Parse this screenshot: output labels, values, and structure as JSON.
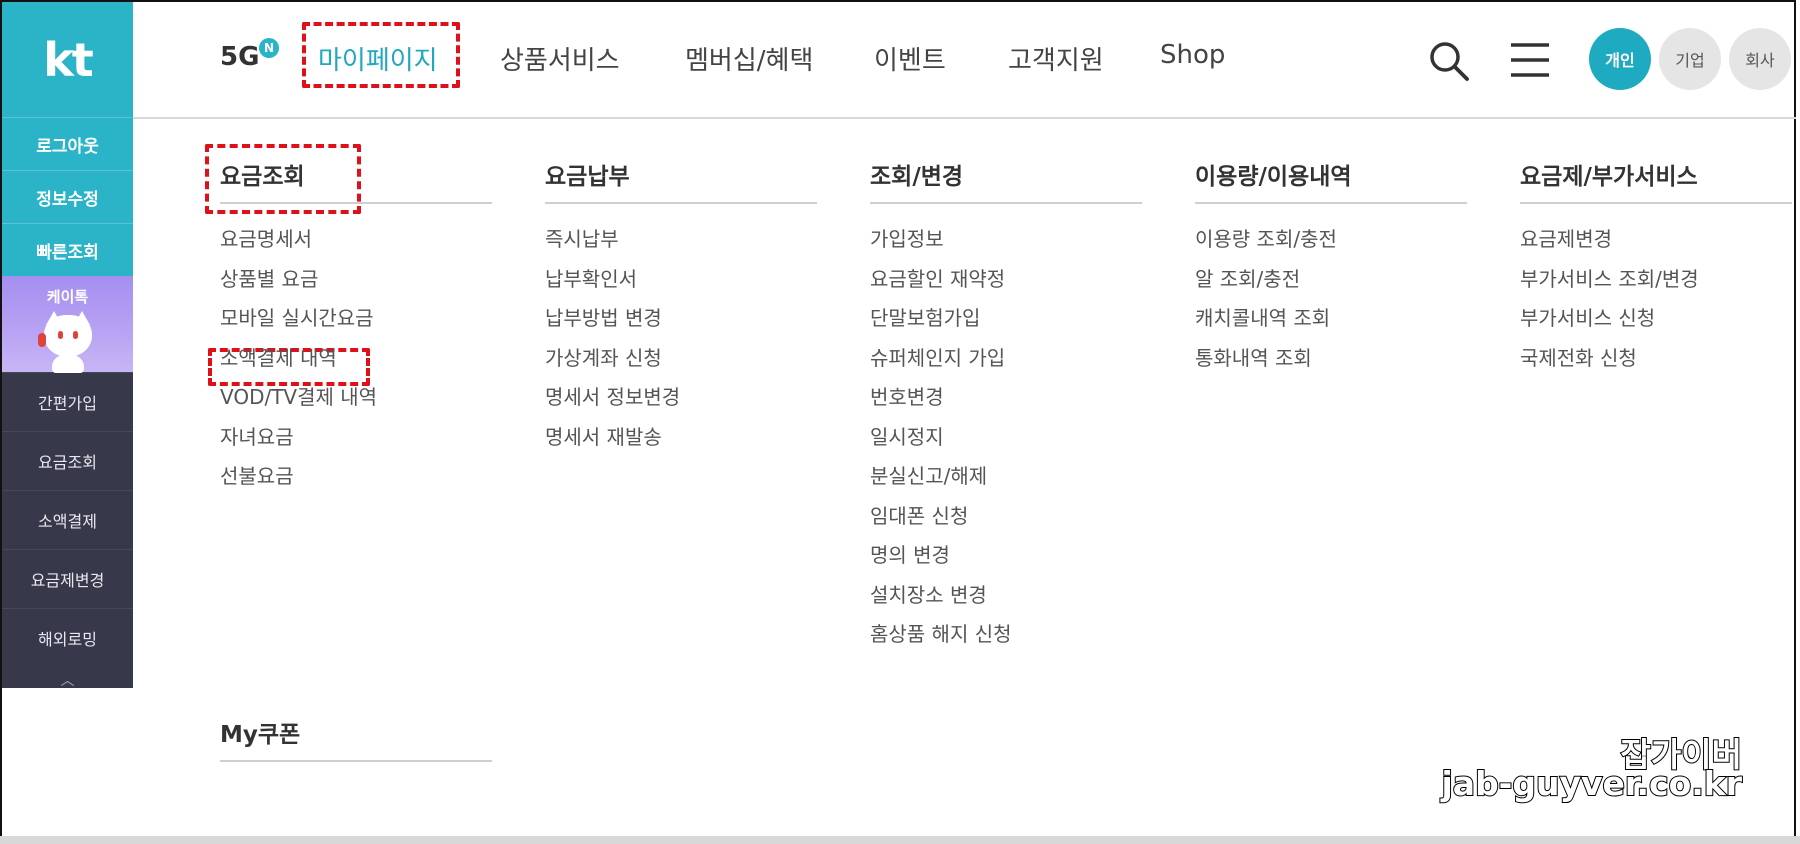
{
  "sidebar": {
    "logo": "kt",
    "quick_items": [
      "로그아웃",
      "정보수정",
      "빠른조회"
    ],
    "ktalk_label": "케이톡",
    "items": [
      "간편가입",
      "요금조회",
      "소액결제",
      "요금제변경",
      "해외로밍"
    ],
    "collapse_glyph": "︿"
  },
  "header": {
    "brand": "5G",
    "badge": "N",
    "nav": [
      "마이페이지",
      "상품서비스",
      "멤버십/혜택",
      "이벤트",
      "고객지원",
      "Shop"
    ],
    "segments": [
      "개인",
      "기업",
      "회사"
    ],
    "accent_color": "#2bb3c7"
  },
  "menu": {
    "columns": [
      {
        "title": "요금조회",
        "items": [
          "요금명세서",
          "상품별 요금",
          "모바일 실시간요금",
          "소액결제 내역",
          "VOD/TV결제 내역",
          "자녀요금",
          "선불요금"
        ]
      },
      {
        "title": "요금납부",
        "items": [
          "즉시납부",
          "납부확인서",
          "납부방법 변경",
          "가상계좌 신청",
          "명세서 정보변경",
          "명세서 재발송"
        ]
      },
      {
        "title": "조회/변경",
        "items": [
          "가입정보",
          "요금할인 재약정",
          "단말보험가입",
          "슈퍼체인지 가입",
          "번호변경",
          "일시정지",
          "분실신고/해제",
          "임대폰 신청",
          "명의 변경",
          "설치장소 변경",
          "홈상품 해지 신청"
        ]
      },
      {
        "title": "이용량/이용내역",
        "items": [
          "이용량 조회/충전",
          "알 조회/충전",
          "캐치콜내역 조회",
          "통화내역 조회"
        ]
      },
      {
        "title": "요금제/부가서비스",
        "items": [
          "요금제변경",
          "부가서비스 조회/변경",
          "부가서비스 신청",
          "국제전화 신청"
        ]
      }
    ],
    "coupon_title": "My쿠폰"
  },
  "watermark": {
    "line1": "잡가이버",
    "line2": "jab-guyver.co.kr"
  },
  "highlight_color": "#e0101a"
}
